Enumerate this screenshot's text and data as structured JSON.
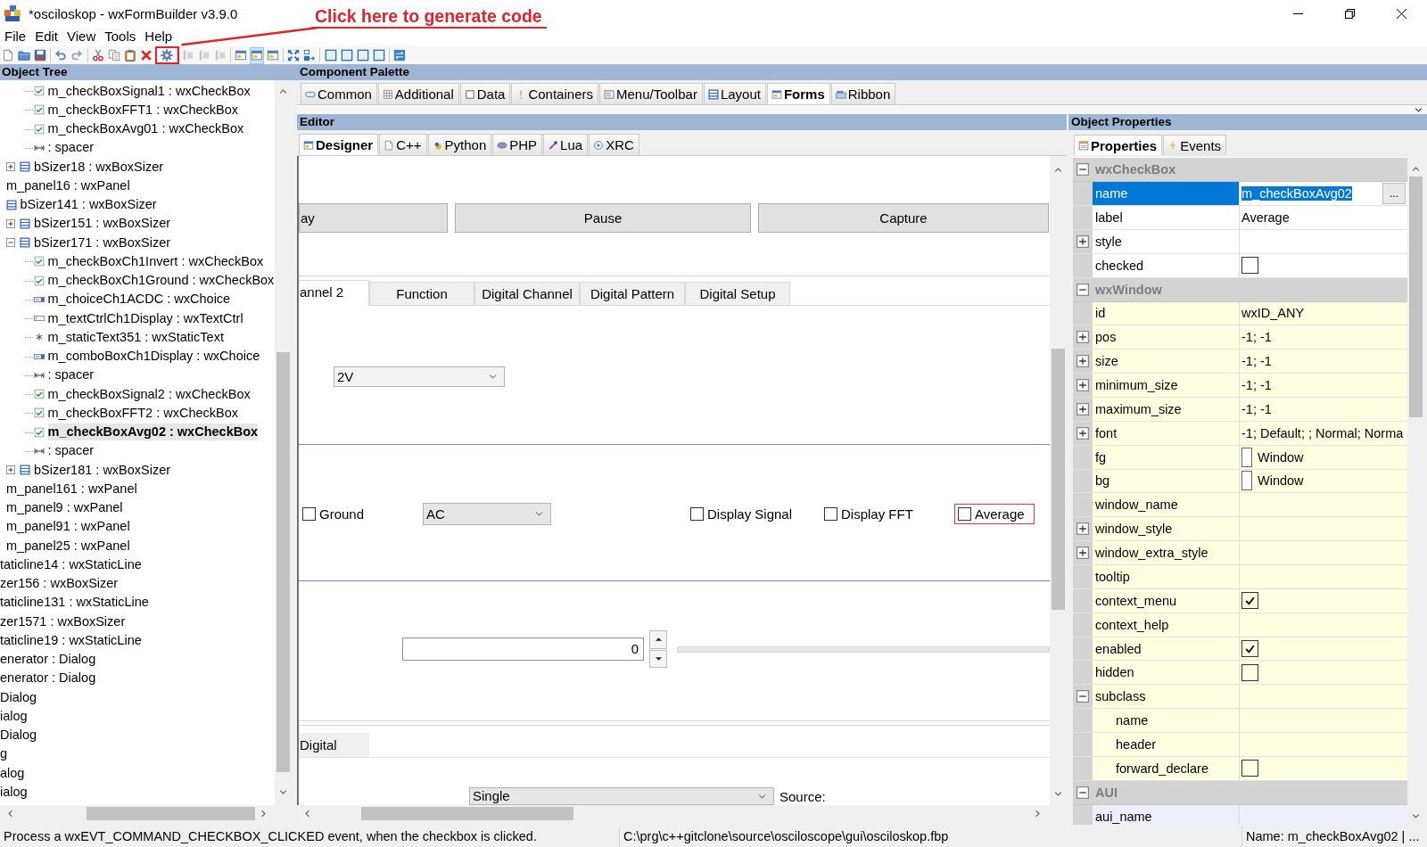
{
  "window": {
    "title": "*osciloskop - wxFormBuilder v3.9.0"
  },
  "annotation": {
    "text": "Click here to generate code"
  },
  "menu": [
    "File",
    "Edit",
    "View",
    "Tools",
    "Help"
  ],
  "toolbar": [
    {
      "disabled": false,
      "on": false,
      "highlighted": false
    },
    {
      "disabled": false,
      "on": false,
      "highlighted": false
    },
    {
      "disabled": false,
      "on": false,
      "highlighted": false
    },
    {
      "disabled": false,
      "on": false,
      "highlighted": false
    },
    {
      "disabled": false,
      "on": false,
      "highlighted": false
    },
    {
      "disabled": false,
      "on": false,
      "highlighted": false
    },
    {
      "disabled": false,
      "on": false,
      "highlighted": false
    },
    {
      "disabled": false,
      "on": false,
      "highlighted": false
    },
    {
      "disabled": false,
      "on": false,
      "highlighted": false
    },
    {
      "disabled": false,
      "on": false,
      "highlighted": true
    },
    {
      "disabled": true,
      "on": false,
      "highlighted": false
    },
    {
      "disabled": true,
      "on": false,
      "highlighted": false
    },
    {
      "disabled": true,
      "on": false,
      "highlighted": false
    },
    {
      "disabled": false,
      "on": false,
      "highlighted": false
    },
    {
      "disabled": false,
      "on": true,
      "highlighted": false
    },
    {
      "disabled": false,
      "on": false,
      "highlighted": false
    },
    {
      "disabled": false,
      "on": false,
      "highlighted": false
    },
    {
      "disabled": false,
      "on": false,
      "highlighted": false
    },
    {
      "disabled": false,
      "on": false,
      "highlighted": false
    },
    {
      "disabled": false,
      "on": false,
      "highlighted": false
    },
    {
      "disabled": false,
      "on": false,
      "highlighted": false
    },
    {
      "disabled": false,
      "on": false,
      "highlighted": false
    },
    {
      "disabled": false,
      "on": false,
      "highlighted": false
    }
  ],
  "object_tree": {
    "title": "Object Tree",
    "nodes": [
      {
        "children": [
          {
            "children": [
              {
                "children": [
                  {
                    "children": [
                      {
                        "children": [
                          {
                            "children": [
                              {
                                "children": [
                                  {
                                    "label": "m_checkBoxSignal1 : wxCheckBox",
                                    "kind": "checkbox",
                                    "selected": false
                                  },
                                  {
                                    "label": "m_checkBoxFFT1 : wxCheckBox",
                                    "kind": "checkbox",
                                    "selected": false
                                  },
                                  {
                                    "label": "m_checkBoxAvg01 : wxCheckBox",
                                    "kind": "checkbox",
                                    "selected": false
                                  },
                                  {
                                    "label": ": spacer",
                                    "kind": "spacer",
                                    "selected": false
                                  }
                                ]
                              },
                              {
                                "label": "bSizer18 : wxBoxSizer",
                                "kind": "sizer",
                                "expanded": false,
                                "selected": false
                              }
                            ]
                          }
                        ]
                      },
                      {
                        "label": "m_panel16 : wxPanel",
                        "selected": false,
                        "children": [
                          {
                            "label": "bSizer141 : wxBoxSizer",
                            "kind": "sizer",
                            "selected": false,
                            "children": [
                              {
                                "label": "bSizer151 : wxBoxSizer",
                                "kind": "sizer",
                                "expanded": false,
                                "selected": false
                              },
                              {
                                "label": "bSizer171 : wxBoxSizer",
                                "kind": "sizer",
                                "expanded": true,
                                "selected": false,
                                "children": [
                                  {
                                    "label": "m_checkBoxCh1Invert : wxCheckBox",
                                    "kind": "checkbox",
                                    "selected": false
                                  },
                                  {
                                    "label": "m_checkBoxCh1Ground : wxCheckBox",
                                    "kind": "checkbox",
                                    "selected": false
                                  },
                                  {
                                    "label": "m_choiceCh1ACDC : wxChoice",
                                    "kind": "choice",
                                    "selected": false
                                  },
                                  {
                                    "label": "m_textCtrlCh1Display : wxTextCtrl",
                                    "kind": "textctrl",
                                    "selected": false
                                  },
                                  {
                                    "label": "m_staticText351 : wxStaticText",
                                    "kind": "statictext",
                                    "selected": false
                                  },
                                  {
                                    "label": "m_comboBoxCh1Display : wxChoice",
                                    "kind": "choice",
                                    "selected": false
                                  },
                                  {
                                    "label": ": spacer",
                                    "kind": "spacer",
                                    "selected": false
                                  },
                                  {
                                    "label": "m_checkBoxSignal2 : wxCheckBox",
                                    "kind": "checkbox",
                                    "selected": false
                                  },
                                  {
                                    "label": "m_checkBoxFFT2 : wxCheckBox",
                                    "kind": "checkbox",
                                    "selected": false
                                  },
                                  {
                                    "label": "m_checkBoxAvg02 : wxCheckBox",
                                    "kind": "checkbox",
                                    "selected": true
                                  },
                                  {
                                    "label": ": spacer",
                                    "kind": "spacer",
                                    "selected": false
                                  }
                                ]
                              },
                              {
                                "label": "bSizer181 : wxBoxSizer",
                                "kind": "sizer",
                                "expanded": false,
                                "selected": false
                              }
                            ]
                          }
                        ]
                      },
                      {
                        "label": "m_panel161 : wxPanel",
                        "selected": false
                      },
                      {
                        "label": "m_panel9 : wxPanel",
                        "selected": false
                      },
                      {
                        "label": "m_panel91 : wxPanel",
                        "selected": false
                      },
                      {
                        "label": "m_panel25 : wxPanel",
                        "selected": false
                      }
                    ]
                  }
                ]
              },
              {
                "label": "taticline14 : wxStaticLine",
                "selected": false
              },
              {
                "label": "zer156 : wxBoxSizer",
                "selected": false
              },
              {
                "label": "taticline131 : wxStaticLine",
                "selected": false
              },
              {
                "label": "zer1571 : wxBoxSizer",
                "selected": false
              },
              {
                "label": "taticline19 : wxStaticLine",
                "selected": false
              }
            ]
          }
        ]
      },
      {
        "label": "enerator : Dialog",
        "selected": false
      },
      {
        "label": "enerator : Dialog",
        "selected": false
      },
      {
        "label": "Dialog",
        "selected": false
      },
      {
        "label": "ialog",
        "selected": false
      },
      {
        "label": "Dialog",
        "selected": false
      },
      {
        "label": "g",
        "selected": false
      },
      {
        "label": "alog",
        "selected": false
      },
      {
        "label": "ialog",
        "selected": false
      }
    ]
  },
  "component_palette": {
    "title": "Component Palette",
    "tabs": [
      {
        "label": "Common",
        "selected": false
      },
      {
        "label": "Additional",
        "selected": false
      },
      {
        "label": "Data",
        "selected": false
      },
      {
        "label": "Containers",
        "selected": false
      },
      {
        "label": "Menu/Toolbar",
        "selected": false
      },
      {
        "label": "Layout",
        "selected": false
      },
      {
        "label": "Forms",
        "selected": true
      },
      {
        "label": "Ribbon",
        "selected": false
      }
    ]
  },
  "editor": {
    "title": "Editor",
    "tabs": [
      {
        "label": "Designer",
        "selected": true
      },
      {
        "label": "C++",
        "selected": false
      },
      {
        "label": "Python",
        "selected": false
      },
      {
        "label": "PHP",
        "selected": false
      },
      {
        "label": "Lua",
        "selected": false
      },
      {
        "label": "XRC",
        "selected": false
      }
    ],
    "form": {
      "buttons": [
        "ay",
        "Pause",
        "Capture"
      ],
      "notebook_tabs": [
        {
          "label": "annel 2",
          "selected": true
        },
        {
          "label": "Function",
          "selected": false
        },
        {
          "label": "Digital Channel",
          "selected": false
        },
        {
          "label": "Digital Pattern",
          "selected": false
        },
        {
          "label": "Digital Setup",
          "selected": false
        }
      ],
      "range_choice": "2V",
      "channel_controls": [
        {
          "kind": "checkbox",
          "label": "Ground",
          "checked": false,
          "selected": false
        },
        {
          "kind": "choice",
          "value": "AC",
          "selected": false
        },
        {
          "kind": "checkbox",
          "label": "Display Signal",
          "checked": false,
          "selected": false
        },
        {
          "kind": "checkbox",
          "label": "Display FFT",
          "checked": false,
          "selected": false
        },
        {
          "kind": "checkbox",
          "label": "Average",
          "checked": false,
          "selected": true
        }
      ],
      "spin_value": "0",
      "lower_tabs": [
        {
          "label": "Digital",
          "selected": false
        }
      ],
      "mode_choice": "Single",
      "source_label": "Source:"
    }
  },
  "object_properties": {
    "title": "Object Properties",
    "tabs": [
      {
        "label": "Properties",
        "selected": true
      },
      {
        "label": "Events",
        "selected": false
      }
    ],
    "categories": [
      {
        "label": "wxCheckBox",
        "expanded": true,
        "color": "#ffffff",
        "rows": [
          {
            "label": "name",
            "kind": "text",
            "value": "m_checkBoxAvg02",
            "button": "...",
            "selected": true
          },
          {
            "label": "label",
            "kind": "text",
            "value": "Average",
            "selected": false
          },
          {
            "label": "style",
            "kind": "text",
            "expanded": false,
            "selected": false
          },
          {
            "label": "checked",
            "kind": "check",
            "checked": false,
            "selected": false
          }
        ]
      },
      {
        "label": "wxWindow",
        "expanded": true,
        "color": "#ffffe1",
        "rows": [
          {
            "label": "id",
            "kind": "text",
            "value": "wxID_ANY",
            "selected": false
          },
          {
            "label": "pos",
            "kind": "text",
            "value": "-1; -1",
            "expanded": false,
            "selected": false
          },
          {
            "label": "size",
            "kind": "text",
            "value": "-1; -1",
            "expanded": false,
            "selected": false
          },
          {
            "label": "minimum_size",
            "kind": "text",
            "value": "-1; -1",
            "expanded": false,
            "selected": false
          },
          {
            "label": "maximum_size",
            "kind": "text",
            "value": "-1; -1",
            "expanded": false,
            "selected": false
          },
          {
            "label": "font",
            "kind": "text",
            "value": "-1; Default; ; Normal; Norma",
            "expanded": false,
            "selected": false
          },
          {
            "label": "fg",
            "kind": "colour",
            "value": "Window",
            "selected": false
          },
          {
            "label": "bg",
            "kind": "colour",
            "value": "Window",
            "selected": false
          },
          {
            "label": "window_name",
            "kind": "text",
            "selected": false
          },
          {
            "label": "window_style",
            "kind": "text",
            "expanded": false,
            "selected": false
          },
          {
            "label": "window_extra_style",
            "kind": "text",
            "expanded": false,
            "selected": false
          },
          {
            "label": "tooltip",
            "kind": "text",
            "selected": false
          },
          {
            "label": "context_menu",
            "kind": "check",
            "checked": true,
            "selected": false
          },
          {
            "label": "context_help",
            "kind": "text",
            "selected": false
          },
          {
            "label": "enabled",
            "kind": "check",
            "checked": true,
            "selected": false
          },
          {
            "label": "hidden",
            "kind": "check",
            "checked": false,
            "selected": false
          },
          {
            "label": "subclass",
            "kind": "text",
            "expanded": true,
            "selected": false,
            "children": [
              {
                "label": "name",
                "kind": "text",
                "selected": false
              },
              {
                "label": "header",
                "kind": "text",
                "selected": false
              },
              {
                "label": "forward_declare",
                "kind": "check",
                "checked": false,
                "selected": false
              }
            ]
          }
        ]
      },
      {
        "label": "AUI",
        "expanded": true,
        "color": "#eeeeff",
        "rows": [
          {
            "label": "aui_name",
            "kind": "text",
            "selected": false
          }
        ]
      }
    ]
  },
  "status_bar": [
    "Process a wxEVT_COMMAND_CHECKBOX_CLICKED event, when the checkbox is clicked.",
    "C:\\prg\\c++gitclone\\source\\osciloscope\\gui\\osciloskop.fbp",
    "Name: m_checkBoxAvg02 | ..."
  ]
}
